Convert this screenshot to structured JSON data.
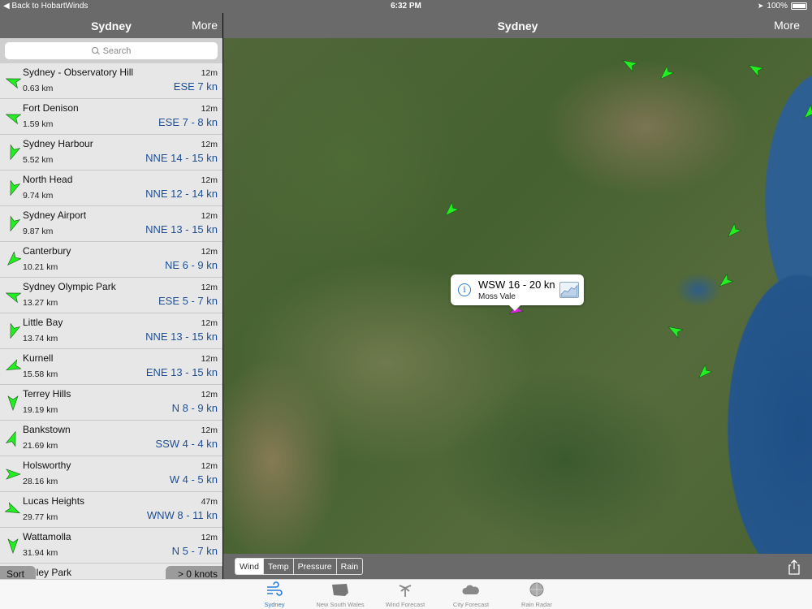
{
  "status_bar": {
    "back_label": "Back to HobartWinds",
    "time": "6:32 PM",
    "battery": "100%"
  },
  "left_nav": {
    "title": "Sydney",
    "more_label": "More"
  },
  "search": {
    "placeholder": "Search"
  },
  "stations": [
    {
      "name": "Sydney - Observatory Hill",
      "distance": "0.63 km",
      "age": "12m",
      "wind": "ESE 7 kn",
      "heading_deg": 290
    },
    {
      "name": "Fort Denison",
      "distance": "1.59 km",
      "age": "12m",
      "wind": "ESE 7 - 8 kn",
      "heading_deg": 290
    },
    {
      "name": "Sydney Harbour",
      "distance": "5.52 km",
      "age": "12m",
      "wind": "NNE 14 - 15 kn",
      "heading_deg": 200
    },
    {
      "name": "North Head",
      "distance": "9.74 km",
      "age": "12m",
      "wind": "NNE 12 - 14 kn",
      "heading_deg": 200
    },
    {
      "name": "Sydney Airport",
      "distance": "9.87 km",
      "age": "12m",
      "wind": "NNE 13 - 15 kn",
      "heading_deg": 200
    },
    {
      "name": "Canterbury",
      "distance": "10.21 km",
      "age": "12m",
      "wind": "NE 6 - 9 kn",
      "heading_deg": 225
    },
    {
      "name": "Sydney Olympic Park",
      "distance": "13.27 km",
      "age": "12m",
      "wind": "ESE 5 - 7 kn",
      "heading_deg": 290
    },
    {
      "name": "Little Bay",
      "distance": "13.74 km",
      "age": "12m",
      "wind": "NNE 13 - 15 kn",
      "heading_deg": 200
    },
    {
      "name": "Kurnell",
      "distance": "15.58 km",
      "age": "12m",
      "wind": "ENE 13 - 15 kn",
      "heading_deg": 245
    },
    {
      "name": "Terrey Hills",
      "distance": "19.19 km",
      "age": "12m",
      "wind": "N 8 - 9 kn",
      "heading_deg": 180
    },
    {
      "name": "Bankstown",
      "distance": "21.69 km",
      "age": "12m",
      "wind": "SSW 4 - 4 kn",
      "heading_deg": 20
    },
    {
      "name": "Holsworthy",
      "distance": "28.16 km",
      "age": "12m",
      "wind": "W 4 - 5 kn",
      "heading_deg": 90
    },
    {
      "name": "Lucas Heights",
      "distance": "29.77 km",
      "age": "47m",
      "wind": "WNW 8 - 11 kn",
      "heading_deg": 115
    },
    {
      "name": "Wattamolla",
      "distance": "31.94 km",
      "age": "12m",
      "wind": "N 5 - 7 kn",
      "heading_deg": 180
    },
    {
      "name": "ersley Park",
      "distance": "",
      "age": "",
      "wind": "",
      "heading_deg": 180
    }
  ],
  "list_controls": {
    "sort_label": "Sort",
    "filter_label": "> 0 knots"
  },
  "right_nav": {
    "title": "Sydney",
    "more_label": "More"
  },
  "callout": {
    "title": "WSW 16 - 20 kn",
    "subtitle": "Moss Vale"
  },
  "map_layers": [
    {
      "label": "Wind",
      "active": true
    },
    {
      "label": "Temp",
      "active": false
    },
    {
      "label": "Pressure",
      "active": false
    },
    {
      "label": "Rain",
      "active": false
    }
  ],
  "tabs": [
    {
      "label": "Sydney",
      "icon": "wind-icon",
      "active": true
    },
    {
      "label": "New South Wales",
      "icon": "state-map-icon",
      "active": false
    },
    {
      "label": "Wind Forecast",
      "icon": "palm-tree-icon",
      "active": false
    },
    {
      "label": "City Forecast",
      "icon": "cloud-icon",
      "active": false
    },
    {
      "label": "Rain Radar",
      "icon": "radar-icon",
      "active": false
    }
  ],
  "colors": {
    "nav_bar": "#6a6a6a",
    "wind_text": "#1f4f93",
    "arrow_green": "#22ee22",
    "arrow_selected": "#e020e0",
    "tab_active": "#2a7cd9"
  }
}
